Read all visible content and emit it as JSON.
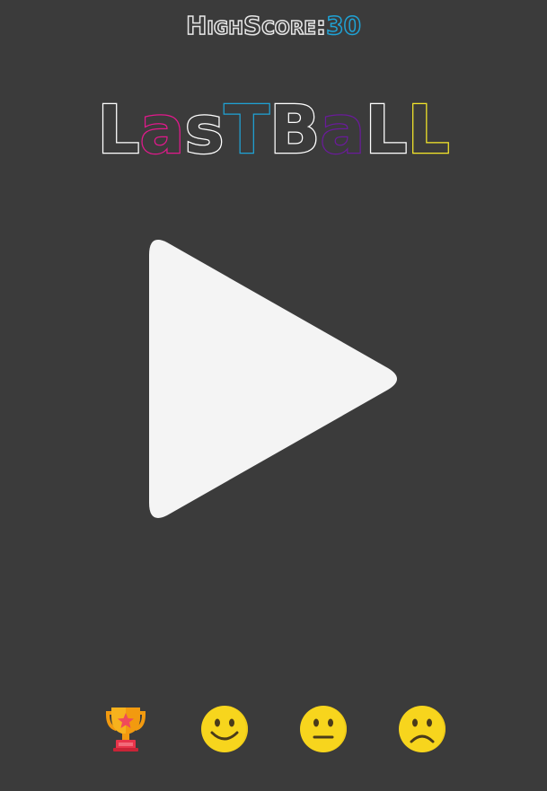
{
  "high_score": {
    "label": "HighScore:",
    "value": "30"
  },
  "title": {
    "letters": [
      {
        "char": "L",
        "color": "#ffffff"
      },
      {
        "char": "a",
        "color": "#e2198c"
      },
      {
        "char": "s",
        "color": "#ffffff"
      },
      {
        "char": "T",
        "color": "#1fa3d6"
      },
      {
        "char": "B",
        "color": "#ffffff"
      },
      {
        "char": "a",
        "color": "#6a1b9a"
      },
      {
        "char": "L",
        "color": "#ffffff"
      },
      {
        "char": "L",
        "color": "#f5e72a"
      }
    ]
  },
  "play_button": {
    "icon": "play-icon",
    "color": "#f4f4f4"
  },
  "bottom_icons": [
    {
      "name": "trophy-icon"
    },
    {
      "name": "smile-face-icon"
    },
    {
      "name": "neutral-face-icon"
    },
    {
      "name": "sad-face-icon"
    }
  ],
  "colors": {
    "background": "#3b3b3b",
    "accent_blue": "#1fa3d6",
    "emoji_yellow": "#f7d51d"
  }
}
